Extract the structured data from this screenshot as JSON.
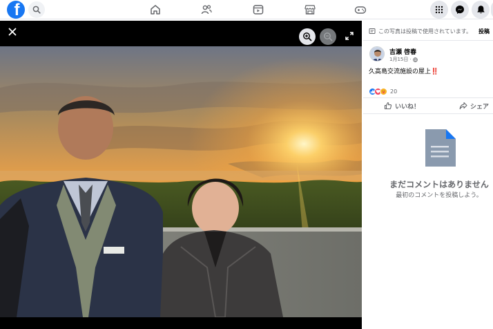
{
  "topbar": {
    "logo_letter": "f",
    "icons": [
      "search-icon",
      "home-icon",
      "friends-icon",
      "video-icon",
      "marketplace-icon",
      "gaming-icon",
      "menu-grid-icon",
      "messenger-icon",
      "notifications-icon"
    ]
  },
  "viewer": {
    "icons": [
      "close-icon",
      "zoom-in-icon",
      "zoom-out-icon",
      "fullscreen-icon"
    ]
  },
  "panel": {
    "notice_text": "この写真は投稿で使用されています。",
    "notice_link": "投稿",
    "author_name": "吉瀬 啓春",
    "post_date": "1月15日",
    "privacy_icon": "public-globe-icon",
    "post_text": "久高島交流施設の屋上",
    "post_emoji": "‼️",
    "reaction_icons": [
      "like-reaction-icon",
      "love-reaction-icon",
      "care-reaction-icon"
    ],
    "reaction_count": "20",
    "like_label": "いいね！",
    "share_label": "シェア",
    "no_comments_title": "まだコメントはありません",
    "no_comments_sub": "最初のコメントを投稿しよう。"
  },
  "colors": {
    "brand_blue": "#1877f2",
    "love_red": "#f33e58",
    "care_yellow": "#f7b125",
    "text_secondary": "#65676b"
  }
}
